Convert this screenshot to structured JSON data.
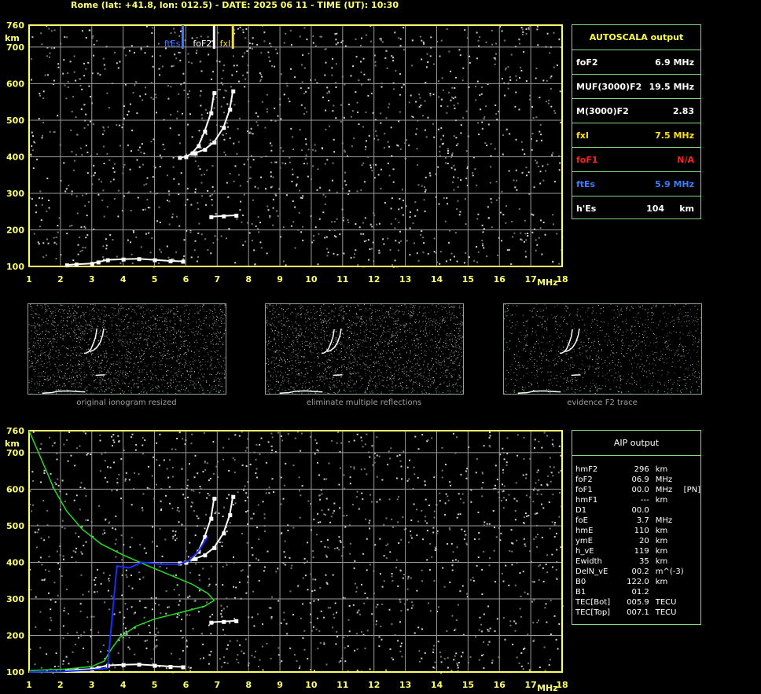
{
  "header": {
    "title": "Rome (lat: +41.8, lon: 012.5) - DATE: 2025 06 11 - TIME (UT): 10:30"
  },
  "colors": {
    "frame": "#ffff66",
    "grid": "#9a9a9a",
    "profile": "#22dd22",
    "fitted_trace": "#1a2cff",
    "ftEs": "#3a7cff",
    "foF2_marker": "#ffffff",
    "fxI_marker": "#ffe000",
    "foF1": "#ff2020",
    "ok_text": "#ffff33"
  },
  "chart_data": [
    {
      "type": "scatter",
      "name_ref": "top-ionogram",
      "xlim": [
        1,
        18
      ],
      "ylim": [
        100,
        760
      ],
      "xticks": [
        "1",
        "2",
        "3",
        "4",
        "5",
        "6",
        "7",
        "8",
        "9",
        "10",
        "11",
        "12",
        "13",
        "14",
        "15",
        "16",
        "17",
        "18"
      ],
      "yticks": [
        "100",
        "200",
        "300",
        "400",
        "500",
        "600",
        "700",
        "760"
      ],
      "xunit": "MHz",
      "yunit": "km",
      "markers": [
        {
          "label": "ftEs",
          "freq": 5.9,
          "color": "#3a7cff"
        },
        {
          "label": "foF2",
          "freq": 6.9,
          "color": "#ffffff"
        },
        {
          "label": "fxI",
          "freq": 7.5,
          "color": "#ffe000"
        }
      ],
      "traces": [
        {
          "layer": "Es",
          "points": [
            [
              2.2,
              104
            ],
            [
              2.5,
              106
            ],
            [
              3,
              108
            ],
            [
              3.2,
              112
            ],
            [
              3.5,
              118
            ],
            [
              4,
              120
            ],
            [
              4.5,
              121
            ],
            [
              5,
              118
            ],
            [
              5.5,
              115
            ],
            [
              5.9,
              114
            ]
          ]
        },
        {
          "layer": "O-F2",
          "points": [
            [
              5.8,
              398
            ],
            [
              6.0,
              400
            ],
            [
              6.2,
              410
            ],
            [
              6.4,
              430
            ],
            [
              6.6,
              470
            ],
            [
              6.8,
              520
            ],
            [
              6.9,
              575
            ]
          ]
        },
        {
          "layer": "X-F2",
          "points": [
            [
              6.3,
              410
            ],
            [
              6.6,
              420
            ],
            [
              6.9,
              440
            ],
            [
              7.2,
              480
            ],
            [
              7.4,
              530
            ],
            [
              7.5,
              580
            ]
          ]
        },
        {
          "layer": "2F2",
          "points": [
            [
              6.8,
              236
            ],
            [
              7.2,
              238
            ],
            [
              7.6,
              240
            ]
          ]
        }
      ]
    },
    {
      "type": "scatter",
      "name_ref": "bottom-ionogram-with-profile",
      "xlim": [
        1,
        18
      ],
      "ylim": [
        100,
        760
      ],
      "xticks": [
        "1",
        "2",
        "3",
        "4",
        "5",
        "6",
        "7",
        "8",
        "9",
        "10",
        "11",
        "12",
        "13",
        "14",
        "15",
        "16",
        "17",
        "18"
      ],
      "yticks": [
        "100",
        "200",
        "300",
        "400",
        "500",
        "600",
        "700",
        "760"
      ],
      "xunit": "MHz",
      "yunit": "km",
      "profile": {
        "points": [
          [
            1.0,
            760
          ],
          [
            1.2,
            720
          ],
          [
            1.5,
            660
          ],
          [
            1.8,
            600
          ],
          [
            2.2,
            540
          ],
          [
            2.7,
            490
          ],
          [
            3.3,
            450
          ],
          [
            4.0,
            420
          ],
          [
            4.8,
            390
          ],
          [
            5.5,
            365
          ],
          [
            6.2,
            340
          ],
          [
            6.7,
            315
          ],
          [
            6.9,
            296
          ],
          [
            6.6,
            280
          ],
          [
            5.8,
            262
          ],
          [
            5.0,
            245
          ],
          [
            4.4,
            225
          ],
          [
            3.9,
            195
          ],
          [
            3.6,
            160
          ],
          [
            3.4,
            130
          ],
          [
            3.0,
            115
          ],
          [
            2.2,
            108
          ],
          [
            1.0,
            104
          ]
        ]
      },
      "fitted": {
        "points": [
          [
            1.0,
            100
          ],
          [
            2.0,
            101
          ],
          [
            3.0,
            106
          ],
          [
            3.5,
            110
          ],
          [
            3.8,
            390
          ],
          [
            4.2,
            385
          ],
          [
            4.6,
            400
          ],
          [
            5.2,
            395
          ],
          [
            5.8,
            395
          ],
          [
            6.1,
            405
          ],
          [
            6.4,
            430
          ],
          [
            6.7,
            470
          ]
        ]
      },
      "traces": [
        {
          "layer": "Es",
          "points": [
            [
              2.2,
              104
            ],
            [
              2.5,
              106
            ],
            [
              3,
              108
            ],
            [
              3.2,
              112
            ],
            [
              3.5,
              118
            ],
            [
              4,
              120
            ],
            [
              4.5,
              121
            ],
            [
              5,
              118
            ],
            [
              5.5,
              115
            ],
            [
              5.9,
              114
            ]
          ]
        },
        {
          "layer": "O-F2",
          "points": [
            [
              5.8,
              398
            ],
            [
              6.0,
              400
            ],
            [
              6.2,
              410
            ],
            [
              6.4,
              430
            ],
            [
              6.6,
              470
            ],
            [
              6.8,
              520
            ],
            [
              6.9,
              575
            ]
          ]
        },
        {
          "layer": "X-F2",
          "points": [
            [
              6.3,
              410
            ],
            [
              6.6,
              420
            ],
            [
              6.9,
              440
            ],
            [
              7.2,
              480
            ],
            [
              7.4,
              530
            ],
            [
              7.5,
              580
            ]
          ]
        },
        {
          "layer": "2F2",
          "points": [
            [
              6.8,
              236
            ],
            [
              7.2,
              238
            ],
            [
              7.6,
              240
            ]
          ]
        }
      ]
    }
  ],
  "thumbnails": [
    {
      "caption": "original ionogram resized"
    },
    {
      "caption": "eliminate multiple reflections"
    },
    {
      "caption": "evidence F2 trace"
    }
  ],
  "autoscala": {
    "title": "AUTOSCALA output",
    "rows": [
      {
        "label": "foF2",
        "value": "6.9 MHz",
        "label_color": "#ffffff",
        "value_color": "#ffffff"
      },
      {
        "label": "MUF(3000)F2",
        "value": "19.5 MHz",
        "label_color": "#ffffff",
        "value_color": "#ffffff"
      },
      {
        "label": "M(3000)F2",
        "value": "2.83",
        "label_color": "#ffffff",
        "value_color": "#ffffff"
      },
      {
        "label": "fxI",
        "value": "7.5 MHz",
        "label_color": "#ffe000",
        "value_color": "#ffe000"
      },
      {
        "label": "foF1",
        "value": "N/A",
        "label_color": "#ff2020",
        "value_color": "#ff2020"
      },
      {
        "label": "ftEs",
        "value": "5.9 MHz",
        "label_color": "#3a7cff",
        "value_color": "#3a7cff"
      },
      {
        "label": "h'Es",
        "value": "104     km",
        "label_color": "#ffffff",
        "value_color": "#ffffff"
      }
    ]
  },
  "aip": {
    "title": "AIP output",
    "rows": [
      {
        "name": "hmF2",
        "value": "296",
        "unit": "km",
        "note": ""
      },
      {
        "name": "foF2",
        "value": "06.9",
        "unit": "MHz",
        "note": ""
      },
      {
        "name": "foF1",
        "value": "00.0",
        "unit": "MHz",
        "note": "[PN]"
      },
      {
        "name": "hmF1",
        "value": "---",
        "unit": "km",
        "note": ""
      },
      {
        "name": "D1",
        "value": "00.0",
        "unit": "",
        "note": ""
      },
      {
        "name": "foE",
        "value": "3.7",
        "unit": "MHz",
        "note": ""
      },
      {
        "name": "hmE",
        "value": "110",
        "unit": "km",
        "note": ""
      },
      {
        "name": "ymE",
        "value": "20",
        "unit": "km",
        "note": ""
      },
      {
        "name": "h_vE",
        "value": "119",
        "unit": "km",
        "note": ""
      },
      {
        "name": "Ewidth",
        "value": "35",
        "unit": "km",
        "note": ""
      },
      {
        "name": "DelN_vE",
        "value": "00.2",
        "unit": "m^(-3)",
        "note": ""
      },
      {
        "name": "B0",
        "value": "122.0",
        "unit": "km",
        "note": ""
      },
      {
        "name": "B1",
        "value": "01.2",
        "unit": "",
        "note": ""
      },
      {
        "name": "TEC[Bot]",
        "value": "005.9",
        "unit": "TECU",
        "note": ""
      },
      {
        "name": "TEC[Top]",
        "value": "007.1",
        "unit": "TECU",
        "note": ""
      }
    ]
  }
}
